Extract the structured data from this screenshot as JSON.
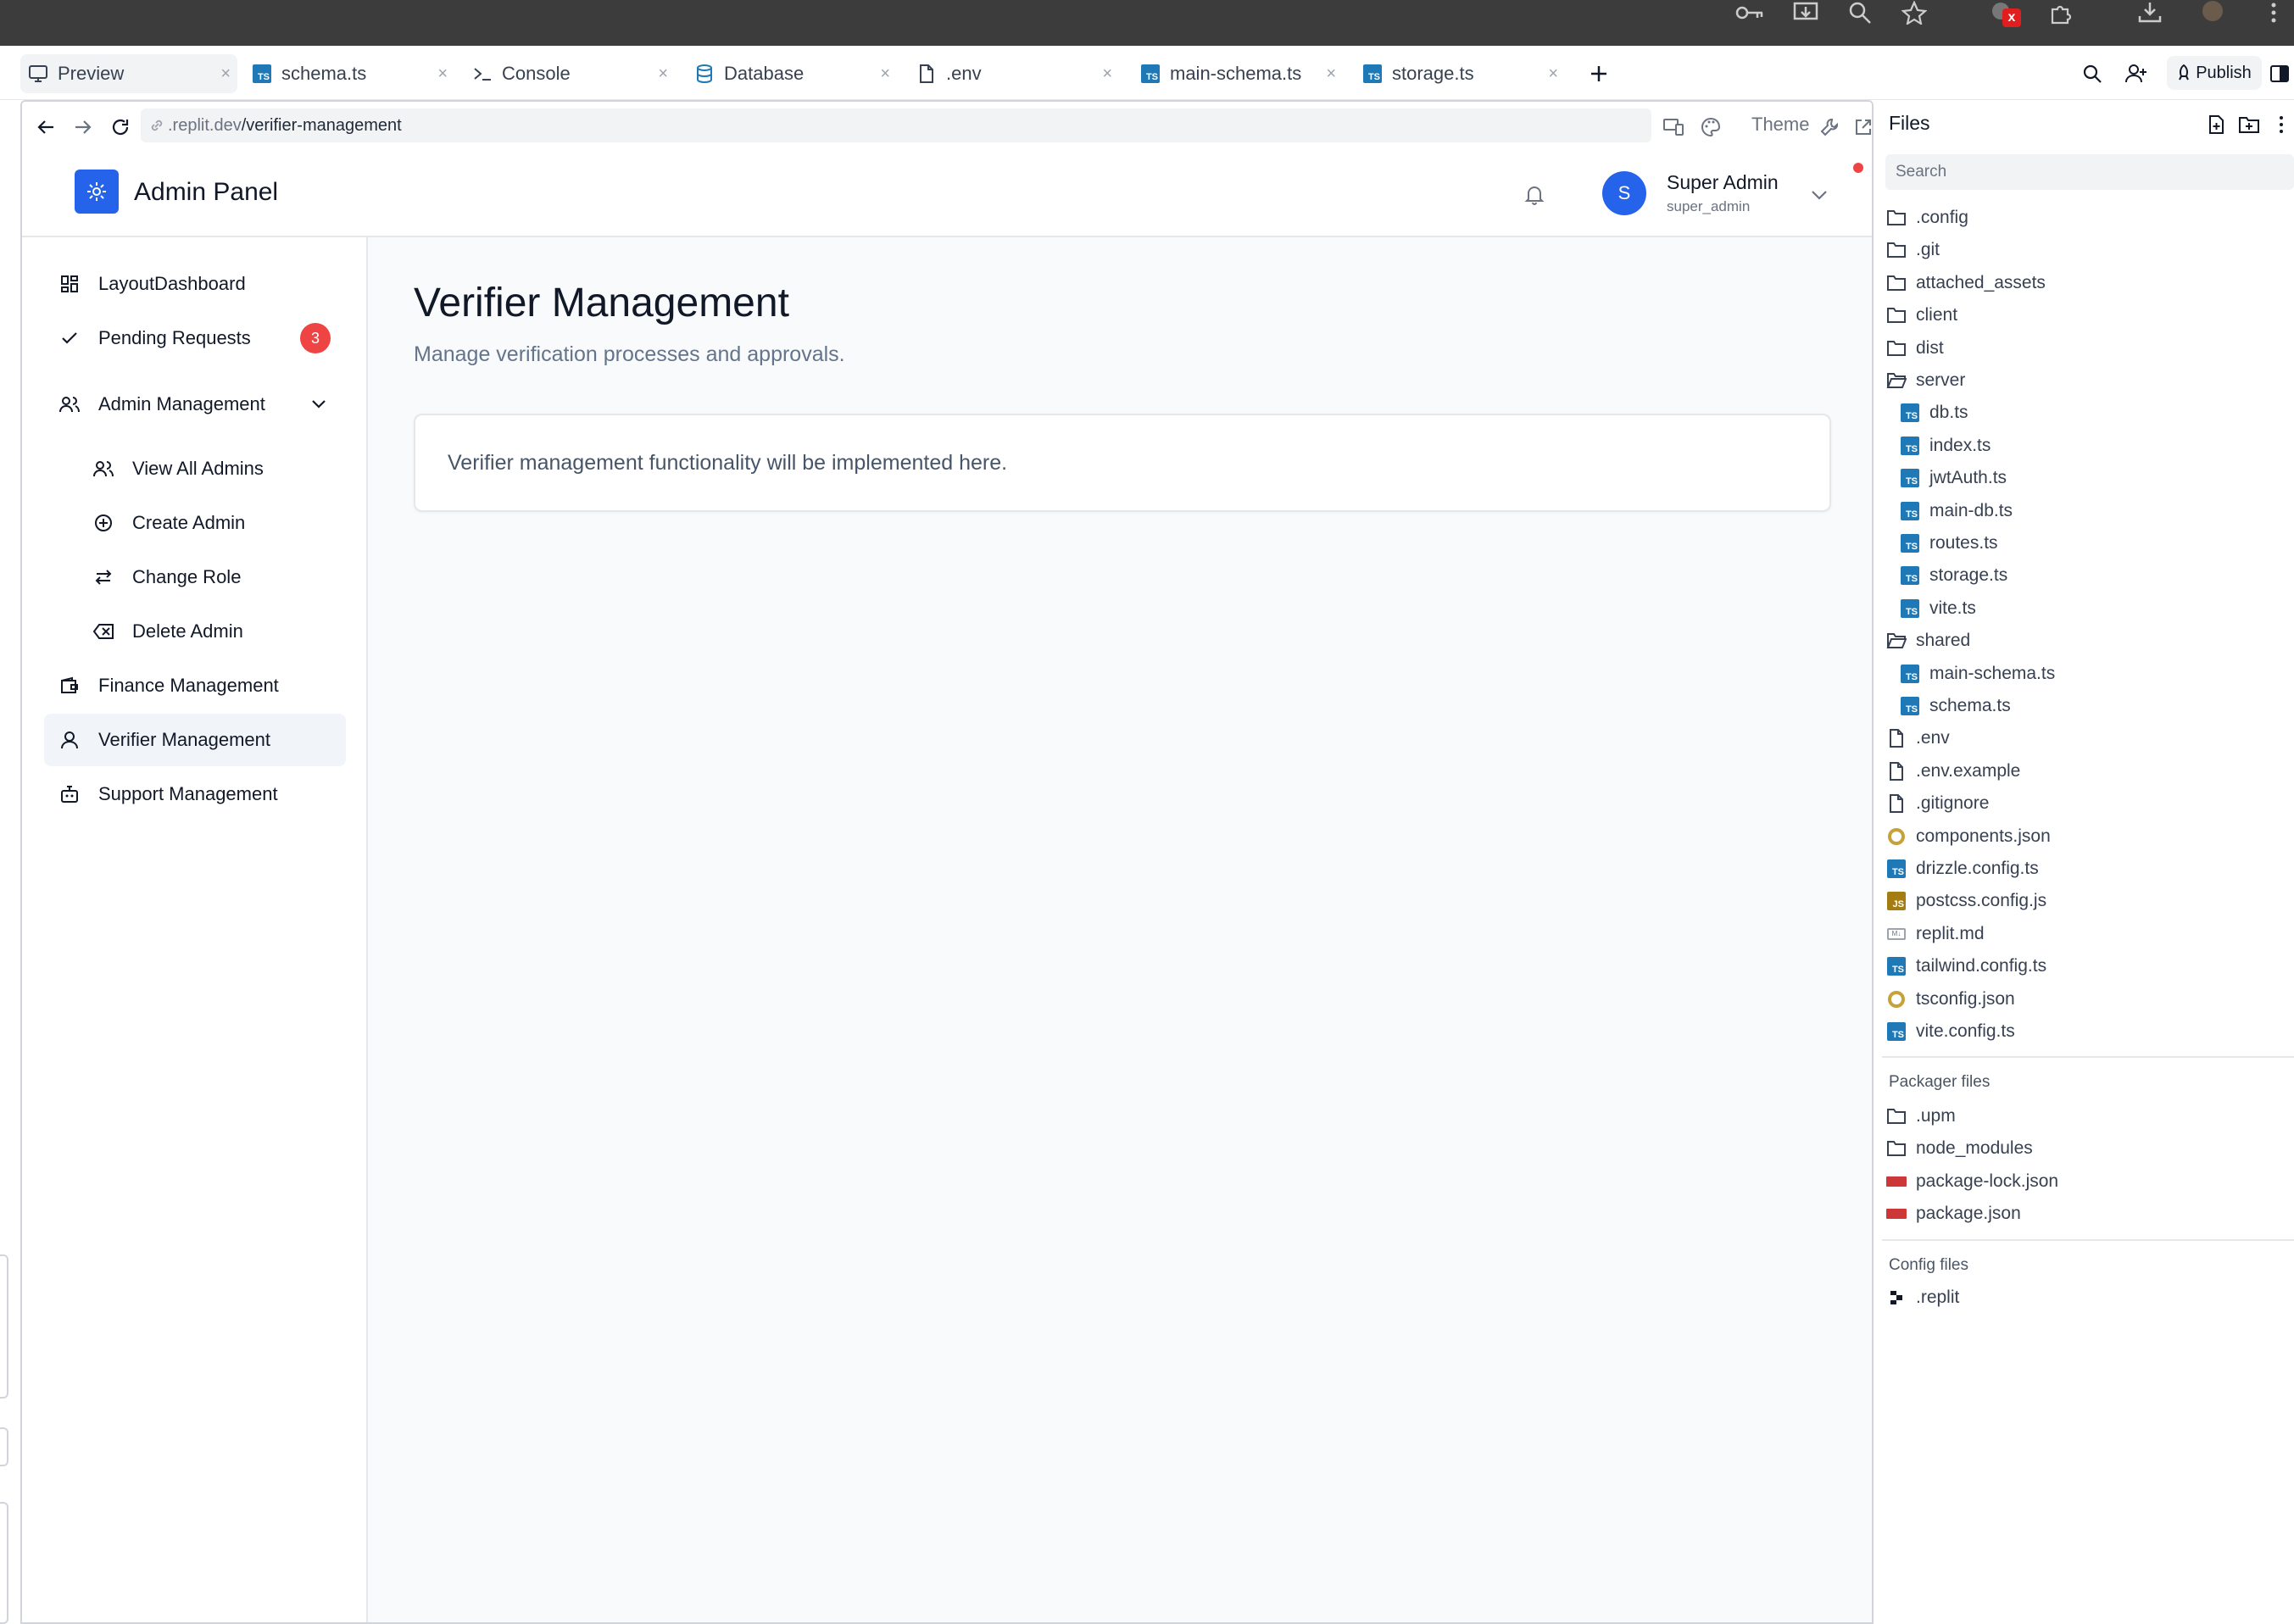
{
  "tabs": [
    {
      "label": "Preview",
      "icon": "monitor-icon",
      "active": true
    },
    {
      "label": "schema.ts",
      "icon": "typescript-file-icon"
    },
    {
      "label": "Console",
      "icon": "terminal-icon"
    },
    {
      "label": "Database",
      "icon": "database-icon"
    },
    {
      "label": ".env",
      "icon": "file-icon"
    },
    {
      "label": "main-schema.ts",
      "icon": "typescript-file-icon"
    },
    {
      "label": "storage.ts",
      "icon": "typescript-file-icon"
    }
  ],
  "toolbar": {
    "publish_label": "Publish"
  },
  "browser": {
    "url_host": ".replit.dev",
    "url_path": "/verifier-management",
    "theme_label": "Theme"
  },
  "app": {
    "title": "Admin Panel",
    "user_name": "Super Admin",
    "user_role": "super_admin",
    "avatar_initial": "S"
  },
  "sidebar": {
    "items": [
      {
        "label": "LayoutDashboard",
        "icon": "layout-dashboard-icon"
      },
      {
        "label": "Pending Requests",
        "icon": "check-icon",
        "badge": "3"
      },
      {
        "label": "Admin Management",
        "icon": "users-icon",
        "expanded": true
      },
      {
        "label": "View All Admins",
        "icon": "users-icon",
        "sub": true
      },
      {
        "label": "Create Admin",
        "icon": "plus-circle-icon",
        "sub": true
      },
      {
        "label": "Change Role",
        "icon": "arrows-swap-icon",
        "sub": true
      },
      {
        "label": "Delete Admin",
        "icon": "delete-backspace-icon",
        "sub": true
      },
      {
        "label": "Finance Management",
        "icon": "wallet-icon"
      },
      {
        "label": "Verifier Management",
        "icon": "user-icon",
        "active": true
      },
      {
        "label": "Support Management",
        "icon": "bot-icon"
      }
    ]
  },
  "main": {
    "title": "Verifier Management",
    "subtitle": "Manage verification processes and approvals.",
    "card_text": "Verifier management functionality will be implemented here."
  },
  "files": {
    "title": "Files",
    "search_placeholder": "Search",
    "tree": [
      {
        "name": ".config",
        "type": "folder"
      },
      {
        "name": ".git",
        "type": "folder"
      },
      {
        "name": "attached_assets",
        "type": "folder"
      },
      {
        "name": "client",
        "type": "folder"
      },
      {
        "name": "dist",
        "type": "folder"
      },
      {
        "name": "server",
        "type": "folder-open"
      },
      {
        "name": "db.ts",
        "type": "ts",
        "indent": 1
      },
      {
        "name": "index.ts",
        "type": "ts",
        "indent": 1
      },
      {
        "name": "jwtAuth.ts",
        "type": "ts",
        "indent": 1
      },
      {
        "name": "main-db.ts",
        "type": "ts",
        "indent": 1
      },
      {
        "name": "routes.ts",
        "type": "ts",
        "indent": 1
      },
      {
        "name": "storage.ts",
        "type": "ts",
        "indent": 1
      },
      {
        "name": "vite.ts",
        "type": "ts",
        "indent": 1
      },
      {
        "name": "shared",
        "type": "folder-open"
      },
      {
        "name": "main-schema.ts",
        "type": "ts",
        "indent": 1
      },
      {
        "name": "schema.ts",
        "type": "ts",
        "indent": 1
      },
      {
        "name": ".env",
        "type": "file"
      },
      {
        "name": ".env.example",
        "type": "file"
      },
      {
        "name": ".gitignore",
        "type": "file"
      },
      {
        "name": "components.json",
        "type": "json"
      },
      {
        "name": "drizzle.config.ts",
        "type": "ts"
      },
      {
        "name": "postcss.config.js",
        "type": "js"
      },
      {
        "name": "replit.md",
        "type": "md"
      },
      {
        "name": "tailwind.config.ts",
        "type": "ts"
      },
      {
        "name": "tsconfig.json",
        "type": "json"
      },
      {
        "name": "vite.config.ts",
        "type": "ts"
      }
    ],
    "packager_label": "Packager files",
    "packager": [
      {
        "name": ".upm",
        "type": "folder"
      },
      {
        "name": "node_modules",
        "type": "folder"
      },
      {
        "name": "package-lock.json",
        "type": "npm"
      },
      {
        "name": "package.json",
        "type": "npm"
      }
    ],
    "config_label": "Config files",
    "config": [
      {
        "name": ".replit",
        "type": "replit"
      }
    ]
  },
  "colors": {
    "accent": "#2563eb",
    "badge": "#ef4444",
    "ts": "#1e79b6",
    "js": "#a57c12"
  }
}
